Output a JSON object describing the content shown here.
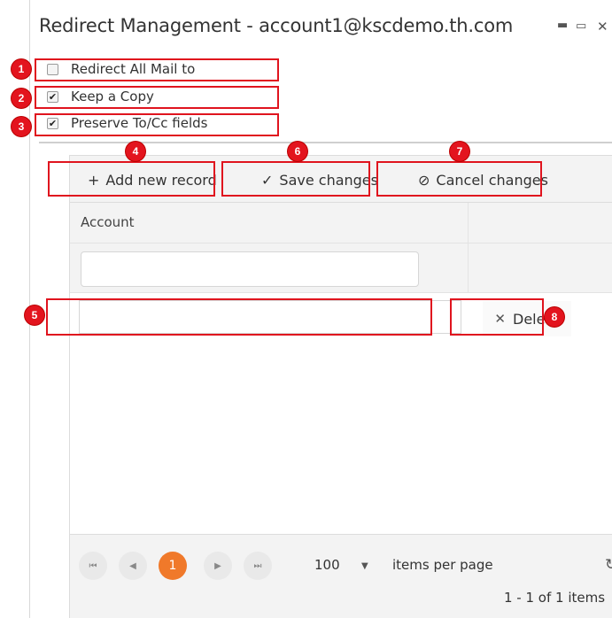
{
  "window": {
    "title": "Redirect Management - account1@kscdemo.th.com",
    "minimize_icon": "minimize-icon",
    "maximize_icon": "maximize-icon",
    "close_icon": "close-icon"
  },
  "options": {
    "redirect_all": {
      "label": "Redirect All Mail to",
      "checked": false
    },
    "keep_copy": {
      "label": "Keep a Copy",
      "checked": true
    },
    "preserve_fields": {
      "label": "Preserve To/Cc fields",
      "checked": true
    }
  },
  "toolbar": {
    "add_label": "Add new record",
    "add_icon": "plus-icon",
    "save_label": "Save changes",
    "save_icon": "check-icon",
    "cancel_label": "Cancel changes",
    "cancel_icon": "cancel-icon"
  },
  "grid": {
    "columns": [
      "Account",
      ""
    ],
    "filter_value": "",
    "rows": [
      {
        "account": "",
        "delete_label": "Delete"
      }
    ]
  },
  "pager": {
    "current_page": "1",
    "page_size": "100",
    "per_page_label": "items per page",
    "info": "1 - 1 of 1 items"
  },
  "annotations": [
    "1",
    "2",
    "3",
    "4",
    "5",
    "6",
    "7",
    "8"
  ],
  "colors": {
    "annotation_red": "#e3141e",
    "active_page": "#f0792a",
    "toolbar_bg": "#f3f3f3"
  }
}
